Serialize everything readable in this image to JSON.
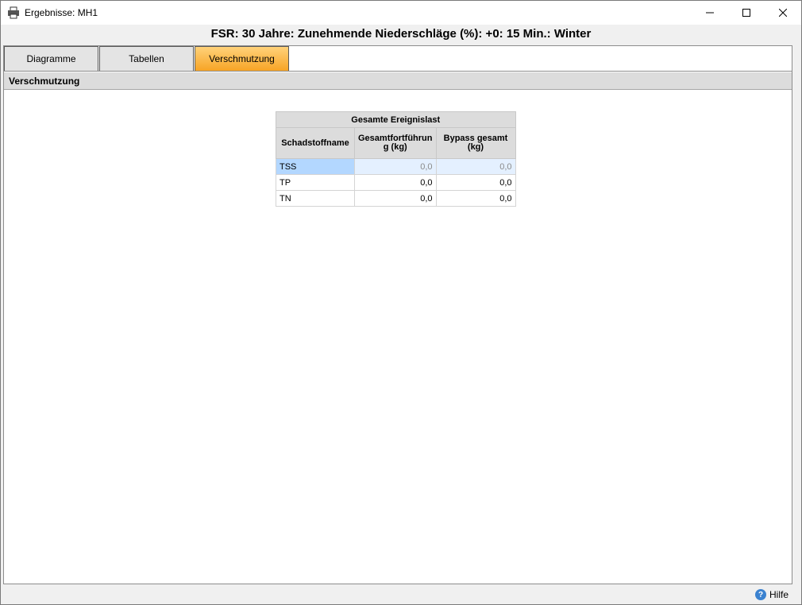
{
  "window": {
    "title": "Ergebnisse: MH1",
    "icon": "printer-icon"
  },
  "header": {
    "title": "FSR: 30 Jahre: Zunehmende Niederschläge (%): +0: 15 Min.: Winter"
  },
  "tabs": [
    {
      "label": "Diagramme",
      "active": false
    },
    {
      "label": "Tabellen",
      "active": false
    },
    {
      "label": "Verschmutzung",
      "active": true
    }
  ],
  "section": {
    "title": "Verschmutzung"
  },
  "table": {
    "group_header": "Gesamte Ereignislast",
    "columns": [
      "Schadstoffname",
      "Gesamtfortführun g (kg)",
      "Bypass gesamt (kg)"
    ],
    "rows": [
      {
        "name": "TSS",
        "total": "0,0",
        "bypass": "0,0",
        "selected": true
      },
      {
        "name": "TP",
        "total": "0,0",
        "bypass": "0,0",
        "selected": false
      },
      {
        "name": "TN",
        "total": "0,0",
        "bypass": "0,0",
        "selected": false
      }
    ]
  },
  "footer": {
    "help_label": "Hilfe",
    "help_icon": "help-icon"
  },
  "colors": {
    "active_tab": "#f7a425",
    "selected_cell": "#b3d7ff",
    "help_icon": "#3b82d0"
  }
}
